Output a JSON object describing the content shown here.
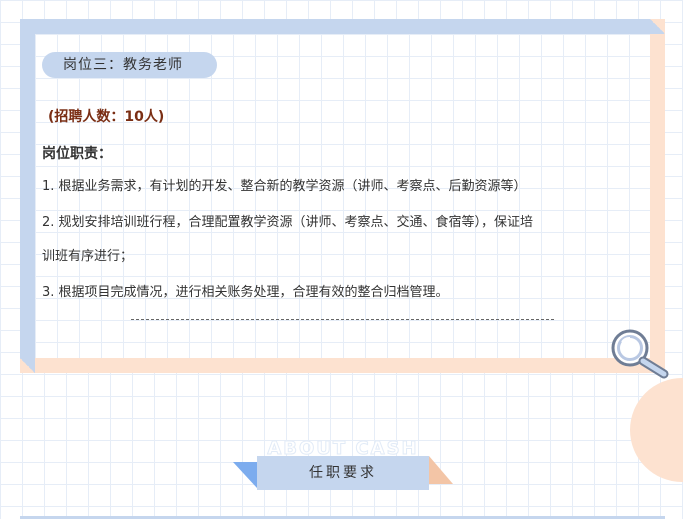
{
  "job_card": {
    "position_title": "岗位三：教务老师",
    "recruit_count": "(招聘人数：10人)",
    "duties_label": "岗位职责：",
    "duties": [
      "1. 根据业务需求，有计划的开发、整合新的教学资源（讲师、考察点、后勤资源等）",
      "2. 规划安排培训班行程，合理配置教学资源（讲师、考察点、交通、食宿等），保证培",
      "训班有序进行；",
      "3. 根据项目完成情况，进行相关账务处理，合理有效的整合归档管理。"
    ]
  },
  "section_banner": {
    "watermark": "ABOUT CASH",
    "title": "任职要求"
  },
  "colors": {
    "frame_blue": "#c5d6ee",
    "frame_peach": "#fde2d0",
    "recruit_text": "#7a2e14",
    "banner_blue_tab": "#7cacee",
    "banner_peach_tab": "#f3c5a6"
  },
  "icons": {
    "magnifier": "magnifying-glass-icon"
  }
}
